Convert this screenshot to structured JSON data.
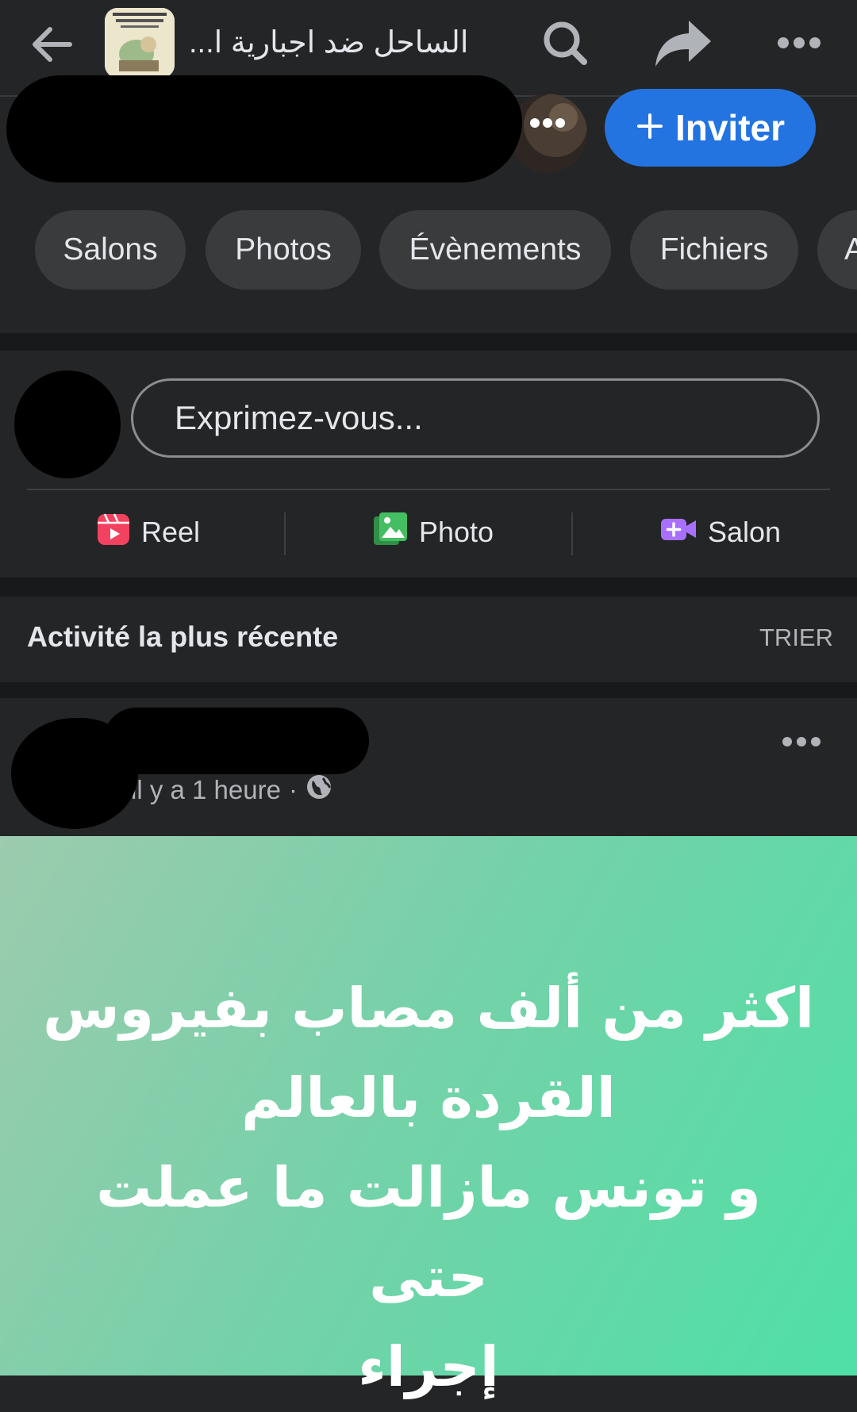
{
  "header": {
    "group_title": "الساحل ضد اجبارية ا...",
    "icons": [
      "back-arrow-icon",
      "search-icon",
      "share-arrow-icon",
      "more-horizontal-icon"
    ]
  },
  "members": {
    "invite_label": "Inviter",
    "invite_color": "#2374e1"
  },
  "tabs": [
    {
      "label": "Salons"
    },
    {
      "label": "Photos"
    },
    {
      "label": "Évènements"
    },
    {
      "label": "Fichiers"
    },
    {
      "label": "A"
    }
  ],
  "composer": {
    "placeholder": "Exprimez-vous...",
    "actions": [
      {
        "label": "Reel",
        "icon": "reel-icon",
        "color": "#f3425f"
      },
      {
        "label": "Photo",
        "icon": "photo-icon",
        "color": "#45bd62"
      },
      {
        "label": "Salon",
        "icon": "video-room-icon",
        "color": "#a970ff"
      }
    ]
  },
  "feed": {
    "title": "Activité la plus récente",
    "sort_label": "TRIER"
  },
  "post": {
    "time": "il y a 1 heure",
    "separator": "·",
    "privacy_icon": "globe-icon",
    "text": "اكثر من ألف مصاب بفيروس\nالقردة بالعالم\nو تونس مازالت ما عملت حتى\nإجراء"
  }
}
